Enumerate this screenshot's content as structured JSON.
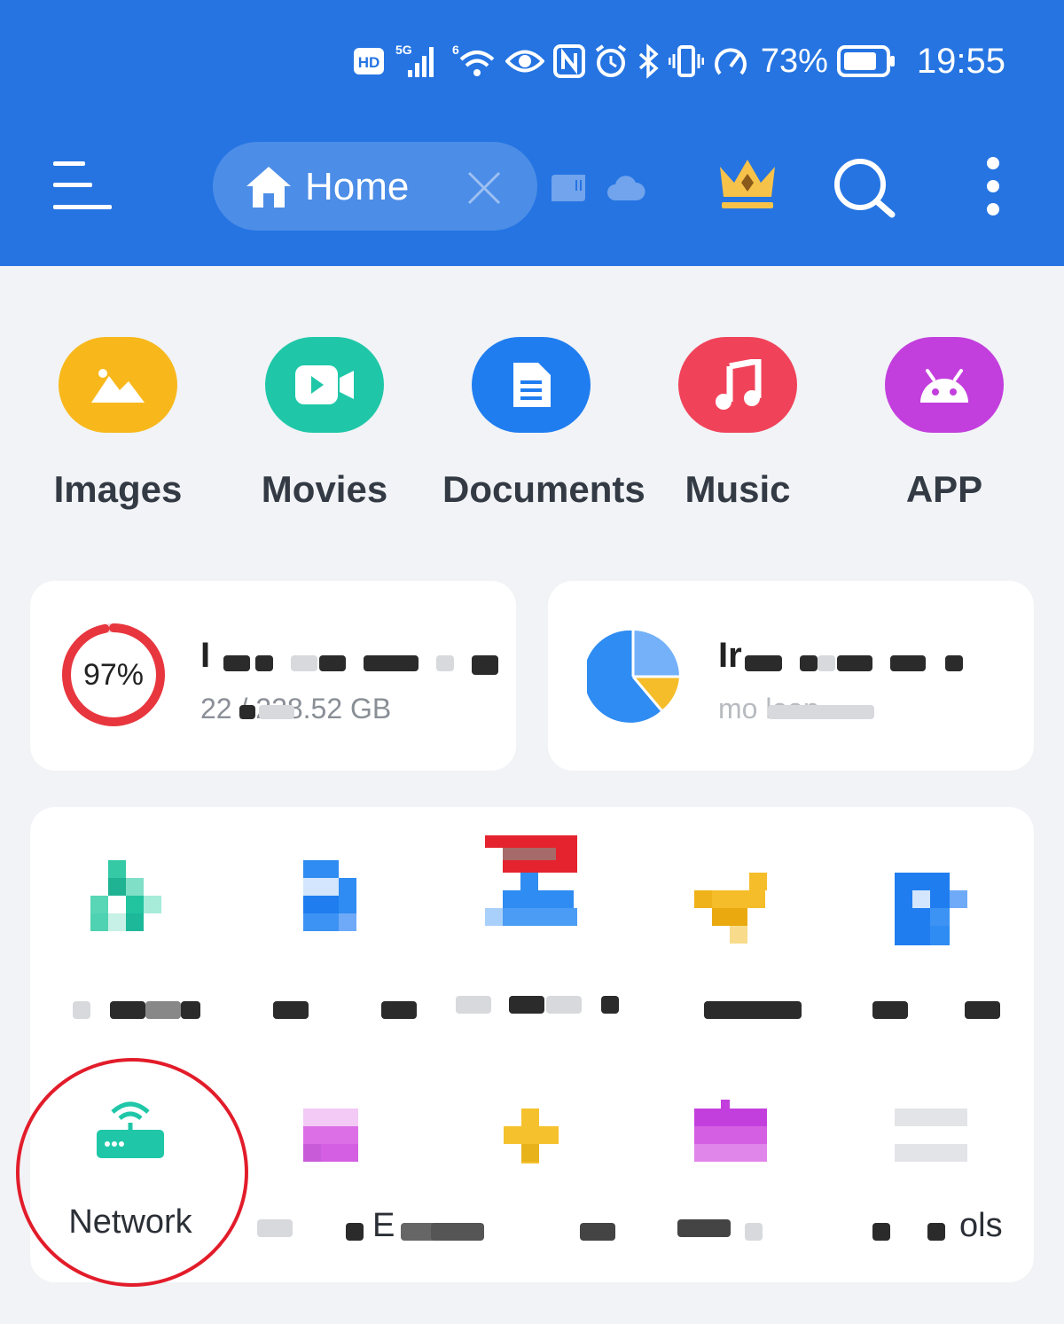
{
  "status_bar": {
    "battery_percent": "73%",
    "time": "19:55",
    "hd_label": "HD",
    "network_label": "5G",
    "wifi_label": "6"
  },
  "toolbar": {
    "tab_label": "Home"
  },
  "categories": [
    {
      "label": "Images",
      "color": "#f8b81c"
    },
    {
      "label": "Movies",
      "color": "#1fc7a8"
    },
    {
      "label": "Documents",
      "color": "#1f7df0"
    },
    {
      "label": "Music",
      "color": "#f0435a"
    },
    {
      "label": "APP",
      "color": "#c33fdd"
    }
  ],
  "storage": {
    "percent_label": "97%",
    "used_fraction": 0.97,
    "title_visible": "I",
    "size_visible": "22  / 228.52 GB",
    "ring_color": "#e8363e"
  },
  "analyze": {
    "title_visible": "Ir",
    "subtitle_visible": "mo           lean"
  },
  "tools": {
    "network_label": "Network",
    "last_label_visible": "ols",
    "e_label_visible": "E"
  },
  "colors": {
    "header": "#2574e2",
    "highlight": "#e21c2a",
    "network_icon": "#1fc7a8"
  }
}
